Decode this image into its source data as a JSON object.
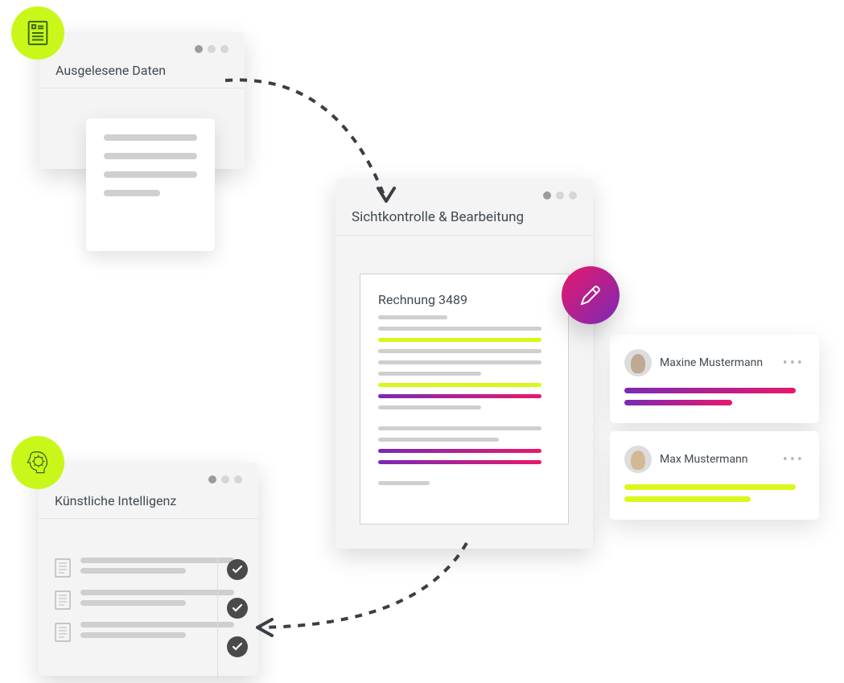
{
  "cards": {
    "data": {
      "title": "Ausgelesene Daten"
    },
    "review": {
      "title": "Sichtkontrolle & Bearbeitung",
      "doc_title": "Rechnung 3489"
    },
    "ai": {
      "title": "Künstliche Intelligenz"
    }
  },
  "comments": [
    {
      "name": "Maxine Mustermann",
      "style": "grad"
    },
    {
      "name": "Max Mustermann",
      "style": "yellow"
    }
  ],
  "icons": {
    "document": "document-icon",
    "ai_head": "ai-head-icon",
    "pencil": "pencil-icon",
    "check": "check-icon"
  },
  "colors": {
    "accent_green": "#c9f71a",
    "gradient_from": "#7a2ab5",
    "gradient_to": "#e8186b",
    "card_bg": "#f4f4f4"
  }
}
